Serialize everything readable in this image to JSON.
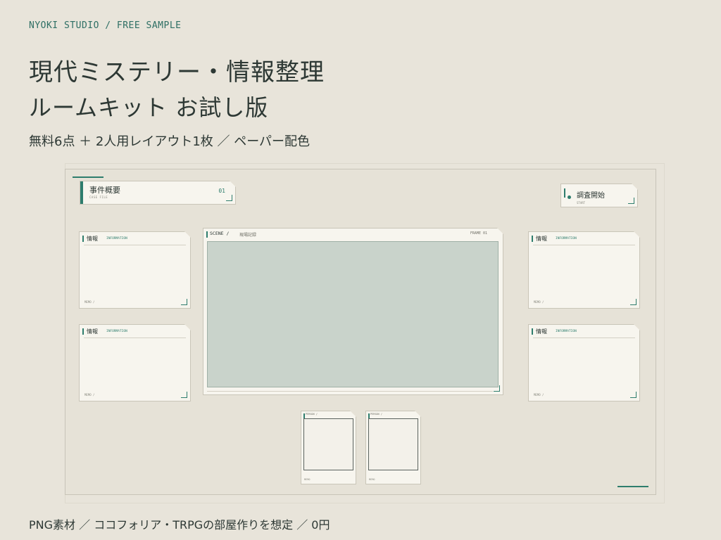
{
  "header": {
    "brand": "NYOKI STUDIO / FREE SAMPLE",
    "title_line1": "現代ミステリー・情報整理",
    "title_line2": "ルームキット お試し版",
    "subtitle": "無料6点 ＋ 2人用レイアウト1枚 ／ ペーパー配色"
  },
  "preview": {
    "case_card": {
      "title": "事件概要",
      "subtitle": "CASE FILE",
      "number": "01"
    },
    "start_card": {
      "title": "調査開始",
      "subtitle": "START"
    },
    "info_cards": [
      {
        "title": "情報",
        "subtitle": "INFORMATION",
        "memo": "MEMO /"
      },
      {
        "title": "情報",
        "subtitle": "INFORMATION",
        "memo": "MEMO /"
      },
      {
        "title": "情報",
        "subtitle": "INFORMATION",
        "memo": "MEMO /"
      },
      {
        "title": "情報",
        "subtitle": "INFORMATION",
        "memo": "MEMO /"
      }
    ],
    "scene": {
      "label": "SCENE /",
      "title": "現場記録",
      "frame": "FRAME 01"
    },
    "persons": [
      {
        "label": "PERSON /",
        "memo": "MEMO"
      },
      {
        "label": "PERSON /",
        "memo": "MEMO"
      }
    ]
  },
  "footer": {
    "text": "PNG素材 ／ ココフォリア・TRPGの部屋作りを想定 ／ 0円"
  },
  "colors": {
    "background": "#e8e4da",
    "paper": "#f7f5ee",
    "accent": "#2e7d6d",
    "scene_fill": "#c9d3cb"
  }
}
